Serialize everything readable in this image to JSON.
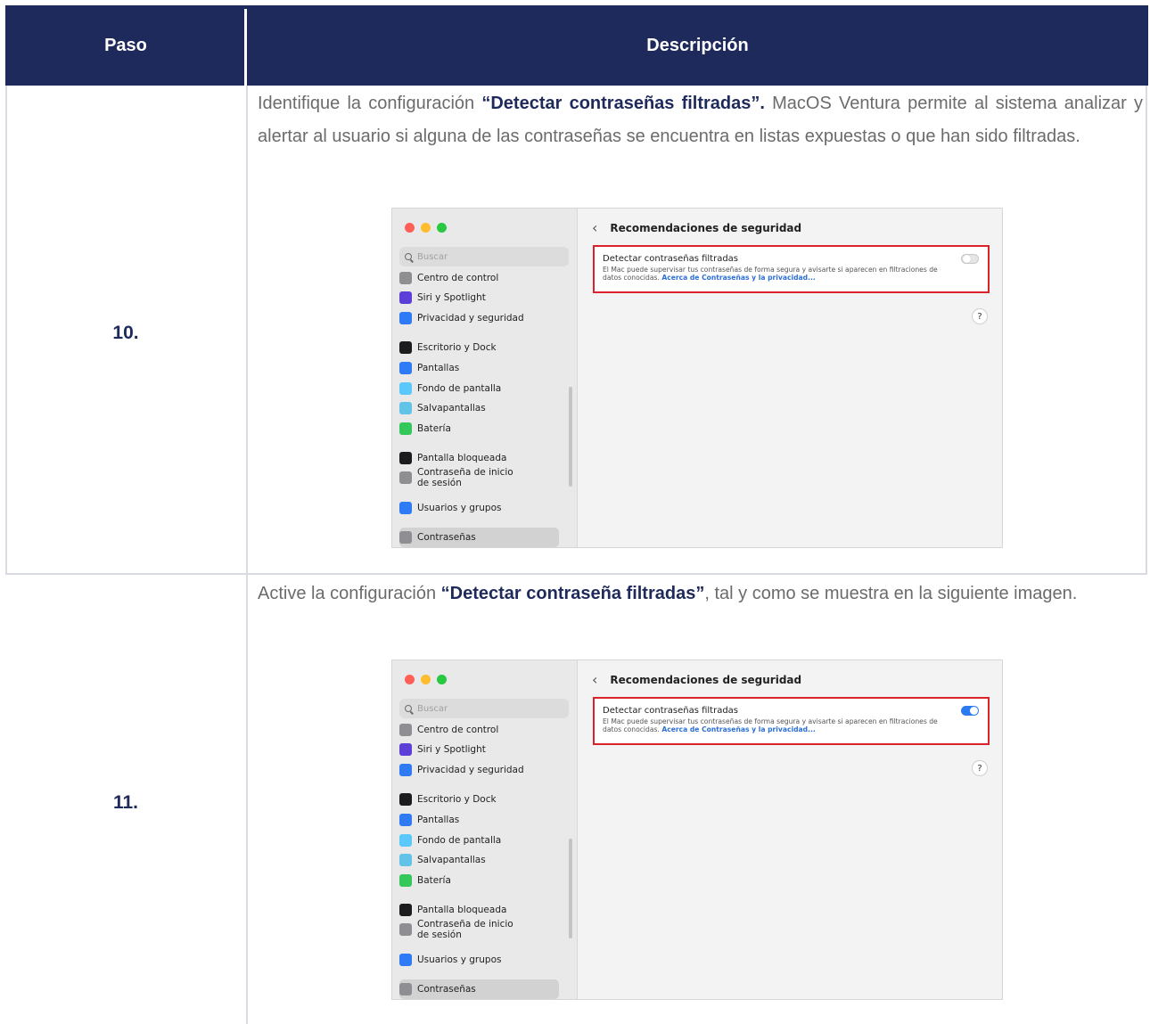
{
  "table": {
    "headers": {
      "step": "Paso",
      "description": "Descripción"
    },
    "rows": [
      {
        "step": "10.",
        "desc_part1": "Identifique la configuración ",
        "desc_bold": "“Detectar contraseñas filtradas”.",
        "desc_part2": " MacOS Ventura permite al sistema analizar y alertar al usuario si alguna de las contraseñas se encuentra en listas expuestas o que han sido filtradas.",
        "toggle_state": "off"
      },
      {
        "step": "11.",
        "desc_part1": "Active la configuración ",
        "desc_bold": "“Detectar contraseña filtradas”",
        "desc_part2": ", tal y como se muestra en la siguiente imagen.",
        "toggle_state": "on"
      }
    ]
  },
  "screenshot": {
    "search_placeholder": "Buscar",
    "pane_title": "Recomendaciones de seguridad",
    "setting_title": "Detectar contraseñas filtradas",
    "setting_desc": "El Mac puede supervisar tus contraseñas de forma segura y avisarte si aparecen en filtraciones de datos conocidas.",
    "setting_link": "Acerca de Contraseñas y la privacidad...",
    "help_label": "?",
    "sidebar": [
      {
        "label": "Centro de control",
        "icon": "control-center-icon",
        "color": "#8e8e93"
      },
      {
        "label": "Siri y Spotlight",
        "icon": "siri-icon",
        "color": "#5b3fd6"
      },
      {
        "label": "Privacidad y seguridad",
        "icon": "hand-icon",
        "color": "#2f7bf5"
      },
      {
        "label": "Escritorio y Dock",
        "icon": "dock-icon",
        "color": "#1c1c1e"
      },
      {
        "label": "Pantallas",
        "icon": "display-icon",
        "color": "#2f7bf5"
      },
      {
        "label": "Fondo de pantalla",
        "icon": "wallpaper-icon",
        "color": "#5ac8fa"
      },
      {
        "label": "Salvapantallas",
        "icon": "screensaver-icon",
        "color": "#62c3e8"
      },
      {
        "label": "Batería",
        "icon": "battery-icon",
        "color": "#34c759"
      },
      {
        "label": "Pantalla bloqueada",
        "icon": "lock-icon",
        "color": "#1c1c1e"
      },
      {
        "label": "Contraseña de inicio",
        "label2": "de sesión",
        "icon": "login-password-icon",
        "color": "#8e8e93"
      },
      {
        "label": "Usuarios y grupos",
        "icon": "users-icon",
        "color": "#2f7bf5"
      },
      {
        "label": "Contraseñas",
        "icon": "key-icon",
        "color": "#8e8e93"
      }
    ],
    "window_dots": [
      "#ff5f57",
      "#febc2e",
      "#28c840"
    ]
  }
}
